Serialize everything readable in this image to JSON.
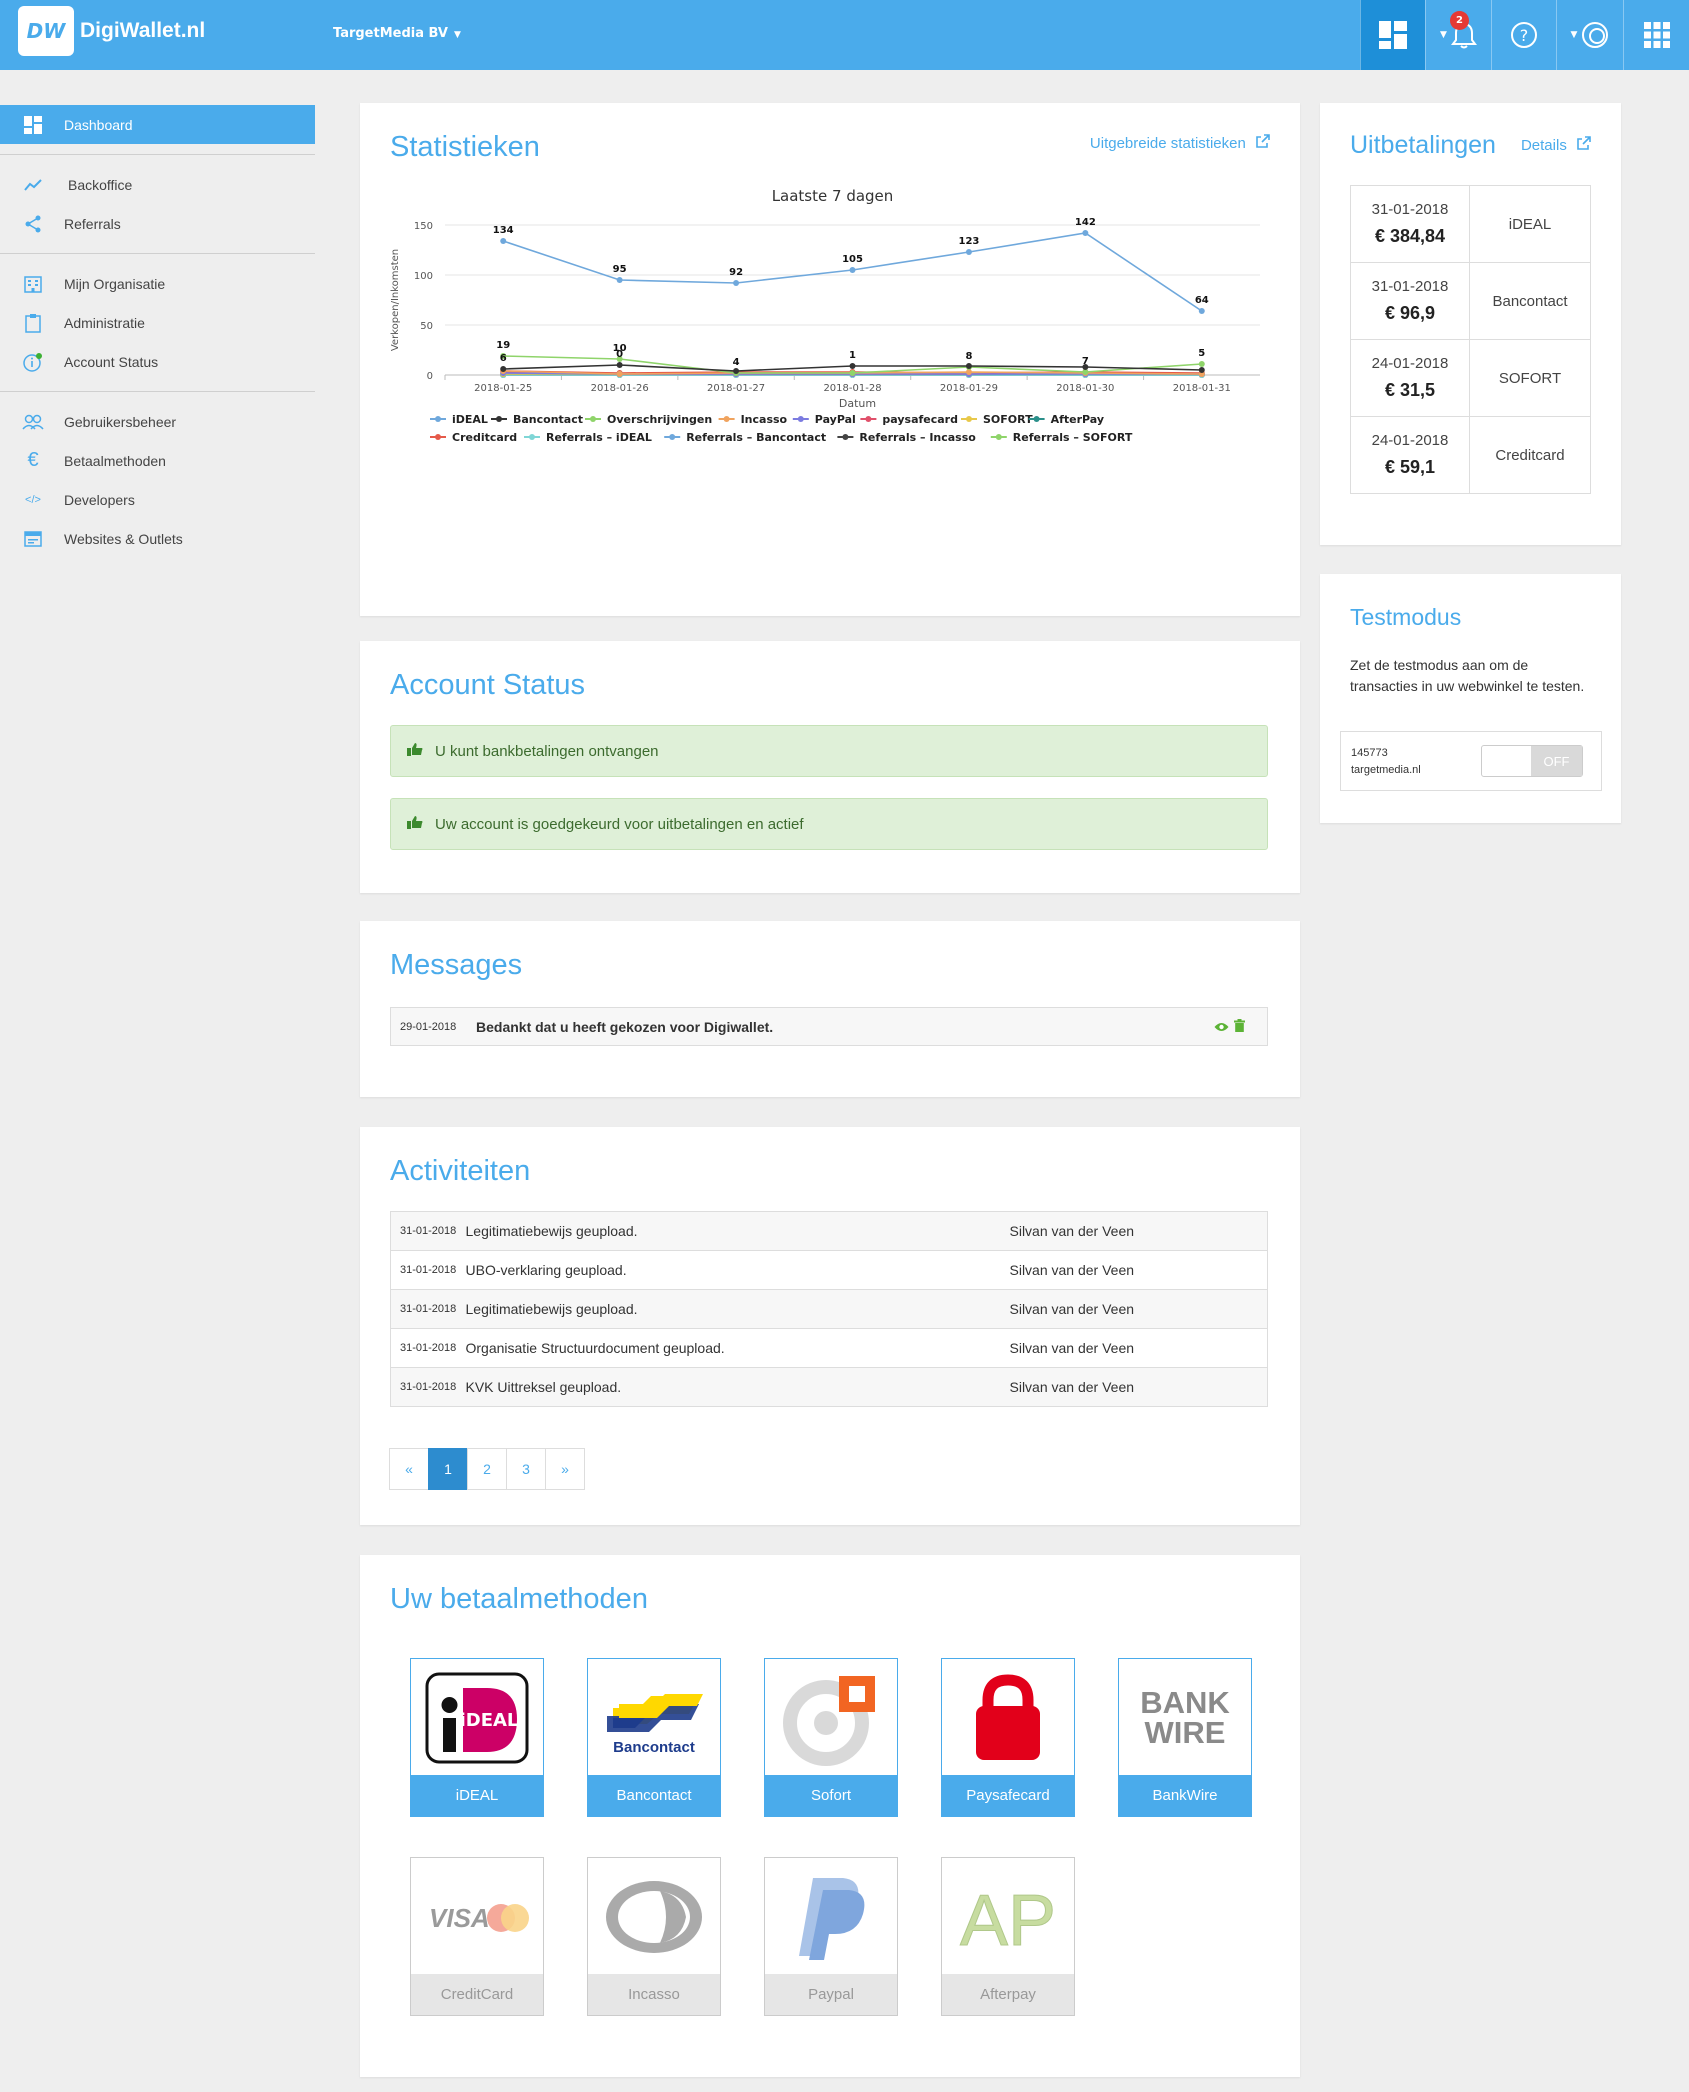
{
  "header": {
    "logo_mark": "DW",
    "logo_text": "DigiWallet.nl",
    "organization": "TargetMedia BV",
    "notification_count": "2"
  },
  "sidebar": {
    "items": [
      {
        "label": "Dashboard",
        "icon": "dashboard-icon"
      },
      {
        "label": "Backoffice",
        "icon": "trend-icon"
      },
      {
        "label": "Referrals",
        "icon": "share-icon"
      },
      {
        "label": "Mijn Organisatie",
        "icon": "building-icon"
      },
      {
        "label": "Administratie",
        "icon": "clipboard-icon"
      },
      {
        "label": "Account Status",
        "icon": "info-icon"
      },
      {
        "label": "Gebruikersbeheer",
        "icon": "users-icon"
      },
      {
        "label": "Betaalmethoden",
        "icon": "euro-icon"
      },
      {
        "label": "Developers",
        "icon": "code-icon"
      },
      {
        "label": "Websites & Outlets",
        "icon": "window-icon"
      }
    ]
  },
  "stats": {
    "title": "Statistieken",
    "link": "Uitgebreide statistieken"
  },
  "chart_data": {
    "type": "line",
    "title": "Laatste 7 dagen",
    "xlabel": "Datum",
    "ylabel": "Verkopen/Inkomsten",
    "categories": [
      "2018-01-25",
      "2018-01-26",
      "2018-01-27",
      "2018-01-28",
      "2018-01-29",
      "2018-01-30",
      "2018-01-31"
    ],
    "ylim": [
      0,
      150
    ],
    "yticks": [
      "0",
      "50",
      "100",
      "150"
    ],
    "legend_position": "bottom",
    "series": [
      {
        "name": "iDEAL",
        "color": "#6fa8dc",
        "values": [
          134,
          95,
          92,
          105,
          123,
          142,
          64
        ],
        "labels": [
          "134",
          "95",
          "92",
          "105",
          "123",
          "142",
          "64"
        ]
      },
      {
        "name": "Bancontact",
        "color": "#333333",
        "values": [
          6,
          10,
          4,
          9,
          9,
          8,
          5
        ],
        "labels": [
          "6",
          "0",
          "",
          "1",
          "",
          "",
          ""
        ]
      },
      {
        "name": "Overschrijvingen",
        "color": "#8fd46a",
        "values": [
          19,
          16,
          2,
          2,
          8,
          3,
          11
        ],
        "labels": [
          "19",
          "10",
          "4",
          "",
          "8",
          "7",
          "5"
        ]
      },
      {
        "name": "Incasso",
        "color": "#f0a35e",
        "values": [
          4,
          1,
          2,
          2,
          3,
          2,
          1
        ],
        "labels": []
      },
      {
        "name": "PayPal",
        "color": "#7b7be0",
        "values": [
          2,
          1,
          1,
          1,
          1,
          1,
          1
        ],
        "labels": []
      },
      {
        "name": "paysafecard",
        "color": "#e0506a",
        "values": [
          3,
          1,
          1,
          1,
          1,
          2,
          1
        ],
        "labels": []
      },
      {
        "name": "SOFORT",
        "color": "#e8c84a",
        "values": [
          1,
          1,
          1,
          1,
          2,
          1,
          1
        ],
        "labels": []
      },
      {
        "name": "AfterPay",
        "color": "#2a8f8a",
        "values": [
          1,
          1,
          1,
          1,
          1,
          1,
          1
        ],
        "labels": []
      },
      {
        "name": "Creditcard",
        "color": "#e55a4a",
        "values": [
          4,
          2,
          3,
          3,
          2,
          3,
          2
        ],
        "labels": []
      },
      {
        "name": "Referrals – iDEAL",
        "color": "#7fd6d6",
        "values": [
          0,
          0,
          0,
          0,
          0,
          0,
          0
        ],
        "labels": []
      },
      {
        "name": "Referrals – Bancontact",
        "color": "#6fa8dc",
        "values": [
          0,
          0,
          0,
          0,
          0,
          0,
          0
        ],
        "labels": []
      },
      {
        "name": "Referrals – Incasso",
        "color": "#444444",
        "values": [
          0,
          0,
          0,
          0,
          0,
          0,
          0
        ],
        "labels": []
      },
      {
        "name": "Referrals – SOFORT",
        "color": "#8fd46a",
        "values": [
          0,
          0,
          0,
          0,
          0,
          0,
          0
        ],
        "labels": []
      }
    ]
  },
  "account_status": {
    "title": "Account Status",
    "alerts": [
      "U kunt bankbetalingen ontvangen",
      "Uw account is goedgekeurd voor uitbetalingen en actief"
    ]
  },
  "messages": {
    "title": "Messages",
    "items": [
      {
        "date": "29-01-2018",
        "text": "Bedankt dat u heeft gekozen voor Digiwallet."
      }
    ]
  },
  "activities": {
    "title": "Activiteiten",
    "rows": [
      {
        "date": "31-01-2018",
        "text": "Legitimatiebewijs geupload.",
        "user": "Silvan van der Veen"
      },
      {
        "date": "31-01-2018",
        "text": "UBO-verklaring geupload.",
        "user": "Silvan van der Veen"
      },
      {
        "date": "31-01-2018",
        "text": "Legitimatiebewijs geupload.",
        "user": "Silvan van der Veen"
      },
      {
        "date": "31-01-2018",
        "text": "Organisatie Structuurdocument geupload.",
        "user": "Silvan van der Veen"
      },
      {
        "date": "31-01-2018",
        "text": "KVK Uittreksel geupload.",
        "user": "Silvan van der Veen"
      }
    ],
    "pagination": [
      "«",
      "1",
      "2",
      "3",
      "»"
    ],
    "current_page": "1"
  },
  "methods": {
    "title": "Uw betaalmethoden",
    "active": [
      "iDEAL",
      "Bancontact",
      "Sofort",
      "Paysafecard",
      "BankWire"
    ],
    "inactive": [
      "CreditCard",
      "Incasso",
      "Paypal",
      "Afterpay"
    ],
    "logo_text": {
      "ideal": "iDEAL",
      "bancontact": "Bancontact",
      "bankwire_1": "BANK",
      "bankwire_2": "WIRE",
      "visa": "VISA",
      "afterpay": "AP"
    }
  },
  "payouts": {
    "title": "Uitbetalingen",
    "link": "Details",
    "rows": [
      {
        "date": "31-01-2018",
        "amount": "€ 384,84",
        "method": "iDEAL"
      },
      {
        "date": "31-01-2018",
        "amount": "€ 96,9",
        "method": "Bancontact"
      },
      {
        "date": "24-01-2018",
        "amount": "€ 31,5",
        "method": "SOFORT"
      },
      {
        "date": "24-01-2018",
        "amount": "€ 59,1",
        "method": "Creditcard"
      }
    ]
  },
  "testmode": {
    "title": "Testmodus",
    "description": "Zet de testmodus aan om de transacties in uw webwinkel te testen.",
    "account_id": "145773",
    "domain": "targetmedia.nl",
    "toggle_label": "OFF"
  }
}
